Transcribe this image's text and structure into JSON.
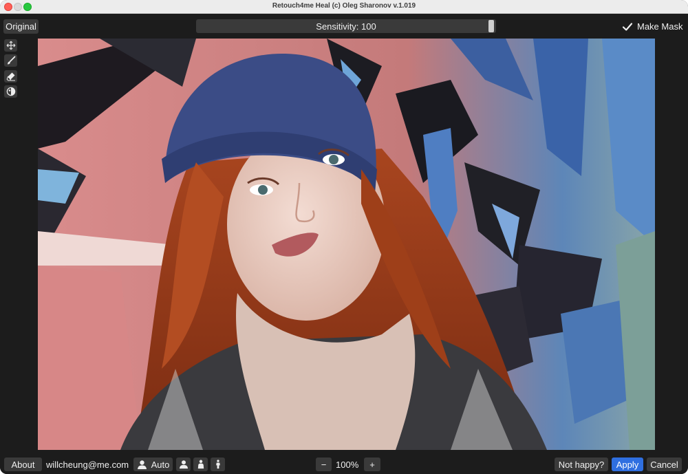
{
  "window": {
    "title": "Retouch4me Heal (c) Oleg Sharonov v.1.019"
  },
  "toolbar": {
    "original_label": "Original",
    "sensitivity_label": "Sensitivity: 100",
    "sensitivity_value": 100,
    "make_mask_label": "Make Mask",
    "make_mask_checked": true
  },
  "tools": [
    "move-icon",
    "brush-icon",
    "eraser-icon",
    "contrast-icon"
  ],
  "bottom": {
    "about_label": "About",
    "email": "willcheung@me.com",
    "auto_label": "Auto",
    "zoom_minus": "−",
    "zoom_value": "100%",
    "zoom_plus": "+",
    "not_happy_label": "Not happy?",
    "apply_label": "Apply",
    "cancel_label": "Cancel"
  },
  "colors": {
    "accent": "#2f6fe0",
    "button": "#3a3a3a",
    "background": "#1c1c1c"
  }
}
